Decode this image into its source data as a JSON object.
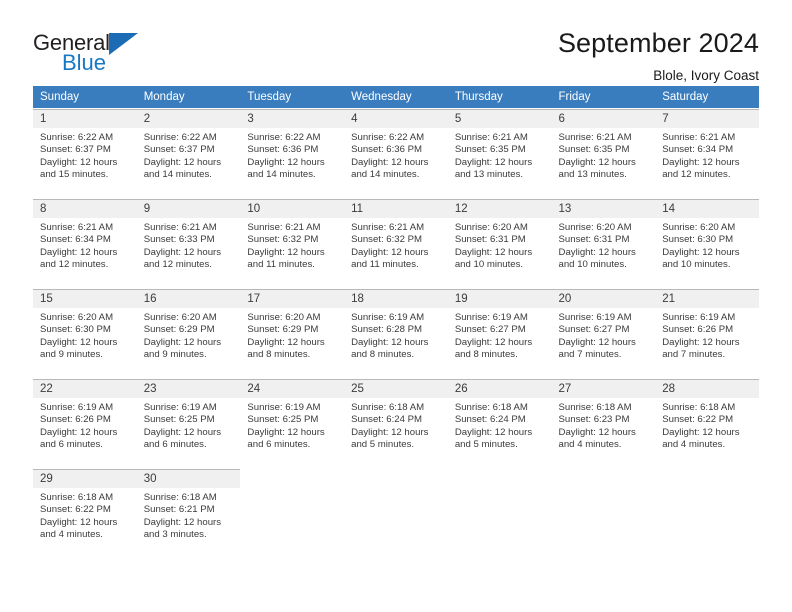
{
  "branding": {
    "name_part1": "General",
    "name_part2": "Blue",
    "flag_icon": "flag-triangle-icon",
    "accent_color": "#1779c4"
  },
  "header": {
    "month_title": "September 2024",
    "location": "Blole, Ivory Coast"
  },
  "calendar": {
    "header_bg": "#3a7dbf",
    "daynum_bg": "#f0f0f0",
    "weekdays": [
      "Sunday",
      "Monday",
      "Tuesday",
      "Wednesday",
      "Thursday",
      "Friday",
      "Saturday"
    ],
    "weeks": [
      [
        {
          "day": "1",
          "sunrise": "Sunrise: 6:22 AM",
          "sunset": "Sunset: 6:37 PM",
          "daylight_line1": "Daylight: 12 hours",
          "daylight_line2": "and 15 minutes."
        },
        {
          "day": "2",
          "sunrise": "Sunrise: 6:22 AM",
          "sunset": "Sunset: 6:37 PM",
          "daylight_line1": "Daylight: 12 hours",
          "daylight_line2": "and 14 minutes."
        },
        {
          "day": "3",
          "sunrise": "Sunrise: 6:22 AM",
          "sunset": "Sunset: 6:36 PM",
          "daylight_line1": "Daylight: 12 hours",
          "daylight_line2": "and 14 minutes."
        },
        {
          "day": "4",
          "sunrise": "Sunrise: 6:22 AM",
          "sunset": "Sunset: 6:36 PM",
          "daylight_line1": "Daylight: 12 hours",
          "daylight_line2": "and 14 minutes."
        },
        {
          "day": "5",
          "sunrise": "Sunrise: 6:21 AM",
          "sunset": "Sunset: 6:35 PM",
          "daylight_line1": "Daylight: 12 hours",
          "daylight_line2": "and 13 minutes."
        },
        {
          "day": "6",
          "sunrise": "Sunrise: 6:21 AM",
          "sunset": "Sunset: 6:35 PM",
          "daylight_line1": "Daylight: 12 hours",
          "daylight_line2": "and 13 minutes."
        },
        {
          "day": "7",
          "sunrise": "Sunrise: 6:21 AM",
          "sunset": "Sunset: 6:34 PM",
          "daylight_line1": "Daylight: 12 hours",
          "daylight_line2": "and 12 minutes."
        }
      ],
      [
        {
          "day": "8",
          "sunrise": "Sunrise: 6:21 AM",
          "sunset": "Sunset: 6:34 PM",
          "daylight_line1": "Daylight: 12 hours",
          "daylight_line2": "and 12 minutes."
        },
        {
          "day": "9",
          "sunrise": "Sunrise: 6:21 AM",
          "sunset": "Sunset: 6:33 PM",
          "daylight_line1": "Daylight: 12 hours",
          "daylight_line2": "and 12 minutes."
        },
        {
          "day": "10",
          "sunrise": "Sunrise: 6:21 AM",
          "sunset": "Sunset: 6:32 PM",
          "daylight_line1": "Daylight: 12 hours",
          "daylight_line2": "and 11 minutes."
        },
        {
          "day": "11",
          "sunrise": "Sunrise: 6:21 AM",
          "sunset": "Sunset: 6:32 PM",
          "daylight_line1": "Daylight: 12 hours",
          "daylight_line2": "and 11 minutes."
        },
        {
          "day": "12",
          "sunrise": "Sunrise: 6:20 AM",
          "sunset": "Sunset: 6:31 PM",
          "daylight_line1": "Daylight: 12 hours",
          "daylight_line2": "and 10 minutes."
        },
        {
          "day": "13",
          "sunrise": "Sunrise: 6:20 AM",
          "sunset": "Sunset: 6:31 PM",
          "daylight_line1": "Daylight: 12 hours",
          "daylight_line2": "and 10 minutes."
        },
        {
          "day": "14",
          "sunrise": "Sunrise: 6:20 AM",
          "sunset": "Sunset: 6:30 PM",
          "daylight_line1": "Daylight: 12 hours",
          "daylight_line2": "and 10 minutes."
        }
      ],
      [
        {
          "day": "15",
          "sunrise": "Sunrise: 6:20 AM",
          "sunset": "Sunset: 6:30 PM",
          "daylight_line1": "Daylight: 12 hours",
          "daylight_line2": "and 9 minutes."
        },
        {
          "day": "16",
          "sunrise": "Sunrise: 6:20 AM",
          "sunset": "Sunset: 6:29 PM",
          "daylight_line1": "Daylight: 12 hours",
          "daylight_line2": "and 9 minutes."
        },
        {
          "day": "17",
          "sunrise": "Sunrise: 6:20 AM",
          "sunset": "Sunset: 6:29 PM",
          "daylight_line1": "Daylight: 12 hours",
          "daylight_line2": "and 8 minutes."
        },
        {
          "day": "18",
          "sunrise": "Sunrise: 6:19 AM",
          "sunset": "Sunset: 6:28 PM",
          "daylight_line1": "Daylight: 12 hours",
          "daylight_line2": "and 8 minutes."
        },
        {
          "day": "19",
          "sunrise": "Sunrise: 6:19 AM",
          "sunset": "Sunset: 6:27 PM",
          "daylight_line1": "Daylight: 12 hours",
          "daylight_line2": "and 8 minutes."
        },
        {
          "day": "20",
          "sunrise": "Sunrise: 6:19 AM",
          "sunset": "Sunset: 6:27 PM",
          "daylight_line1": "Daylight: 12 hours",
          "daylight_line2": "and 7 minutes."
        },
        {
          "day": "21",
          "sunrise": "Sunrise: 6:19 AM",
          "sunset": "Sunset: 6:26 PM",
          "daylight_line1": "Daylight: 12 hours",
          "daylight_line2": "and 7 minutes."
        }
      ],
      [
        {
          "day": "22",
          "sunrise": "Sunrise: 6:19 AM",
          "sunset": "Sunset: 6:26 PM",
          "daylight_line1": "Daylight: 12 hours",
          "daylight_line2": "and 6 minutes."
        },
        {
          "day": "23",
          "sunrise": "Sunrise: 6:19 AM",
          "sunset": "Sunset: 6:25 PM",
          "daylight_line1": "Daylight: 12 hours",
          "daylight_line2": "and 6 minutes."
        },
        {
          "day": "24",
          "sunrise": "Sunrise: 6:19 AM",
          "sunset": "Sunset: 6:25 PM",
          "daylight_line1": "Daylight: 12 hours",
          "daylight_line2": "and 6 minutes."
        },
        {
          "day": "25",
          "sunrise": "Sunrise: 6:18 AM",
          "sunset": "Sunset: 6:24 PM",
          "daylight_line1": "Daylight: 12 hours",
          "daylight_line2": "and 5 minutes."
        },
        {
          "day": "26",
          "sunrise": "Sunrise: 6:18 AM",
          "sunset": "Sunset: 6:24 PM",
          "daylight_line1": "Daylight: 12 hours",
          "daylight_line2": "and 5 minutes."
        },
        {
          "day": "27",
          "sunrise": "Sunrise: 6:18 AM",
          "sunset": "Sunset: 6:23 PM",
          "daylight_line1": "Daylight: 12 hours",
          "daylight_line2": "and 4 minutes."
        },
        {
          "day": "28",
          "sunrise": "Sunrise: 6:18 AM",
          "sunset": "Sunset: 6:22 PM",
          "daylight_line1": "Daylight: 12 hours",
          "daylight_line2": "and 4 minutes."
        }
      ],
      [
        {
          "day": "29",
          "sunrise": "Sunrise: 6:18 AM",
          "sunset": "Sunset: 6:22 PM",
          "daylight_line1": "Daylight: 12 hours",
          "daylight_line2": "and 4 minutes."
        },
        {
          "day": "30",
          "sunrise": "Sunrise: 6:18 AM",
          "sunset": "Sunset: 6:21 PM",
          "daylight_line1": "Daylight: 12 hours",
          "daylight_line2": "and 3 minutes."
        },
        {
          "day": "",
          "sunrise": "",
          "sunset": "",
          "daylight_line1": "",
          "daylight_line2": ""
        },
        {
          "day": "",
          "sunrise": "",
          "sunset": "",
          "daylight_line1": "",
          "daylight_line2": ""
        },
        {
          "day": "",
          "sunrise": "",
          "sunset": "",
          "daylight_line1": "",
          "daylight_line2": ""
        },
        {
          "day": "",
          "sunrise": "",
          "sunset": "",
          "daylight_line1": "",
          "daylight_line2": ""
        },
        {
          "day": "",
          "sunrise": "",
          "sunset": "",
          "daylight_line1": "",
          "daylight_line2": ""
        }
      ]
    ]
  }
}
